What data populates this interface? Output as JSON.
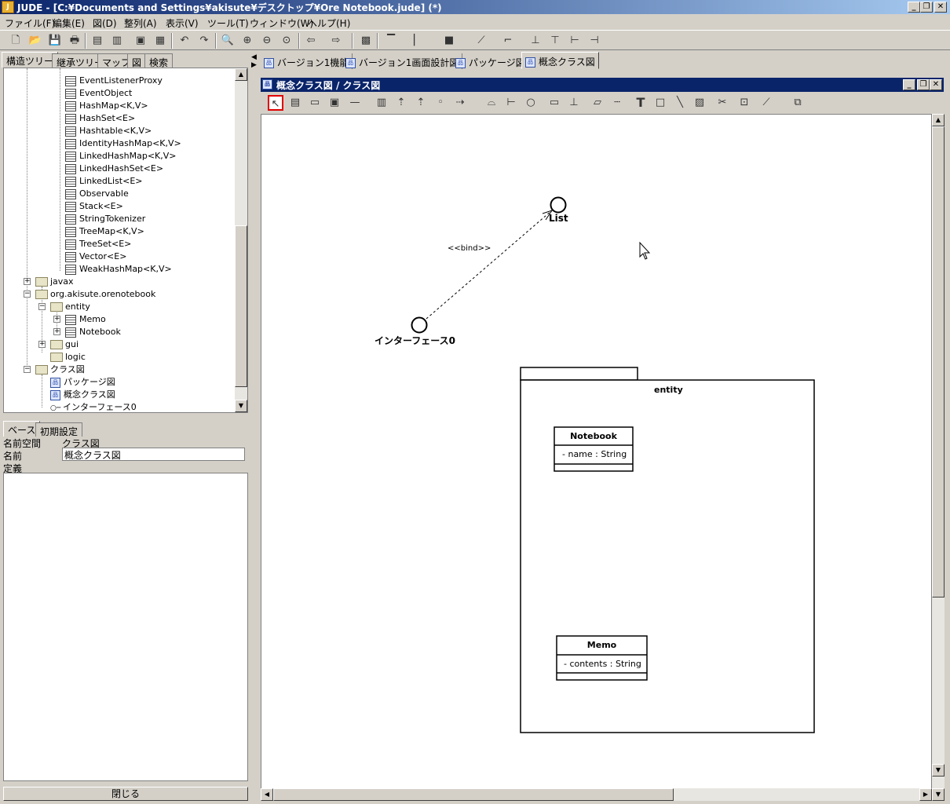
{
  "window": {
    "title": "JUDE - [C:¥Documents and Settings¥akisute¥デスクトップ¥Ore Notebook.jude] (*)",
    "icon_label": "J"
  },
  "menu": [
    "ファイル(F)",
    "編集(E)",
    "図(D)",
    "整列(A)",
    "表示(V)",
    "ツール(T)",
    "ウィンドウ(W)",
    "ヘルプ(H)"
  ],
  "left_tabs": [
    "構造ツリー",
    "継承ツリー",
    "マップ",
    "図",
    "検索"
  ],
  "tree": {
    "classes": [
      "EventListenerProxy",
      "EventObject",
      "HashMap<K,V>",
      "HashSet<E>",
      "Hashtable<K,V>",
      "IdentityHashMap<K,V>",
      "LinkedHashMap<K,V>",
      "LinkedHashSet<E>",
      "LinkedList<E>",
      "Observable",
      "Stack<E>",
      "StringTokenizer",
      "TreeMap<K,V>",
      "TreeSet<E>",
      "Vector<E>",
      "WeakHashMap<K,V>"
    ],
    "javax": "javax",
    "org": "org.akisute.orenotebook",
    "entity": "entity",
    "memo": "Memo",
    "notebook": "Notebook",
    "gui": "gui",
    "logic": "logic",
    "classdiagram": "クラス図",
    "package_diagram": "パッケージ図",
    "concept_diagram": "概念クラス図",
    "interface0": "インターフェース0"
  },
  "prop_tabs": [
    "ベース",
    "初期設定"
  ],
  "props": {
    "namespace_label": "名前空間",
    "namespace_value": "クラス図",
    "name_label": "名前",
    "name_value": "概念クラス図",
    "definition_label": "定義"
  },
  "close_label": "閉じる",
  "diagram_tabs": [
    "バージョン1機能",
    "バージョン1画面設計図",
    "パッケージ図",
    "概念クラス図"
  ],
  "frame_title": "概念クラス図 / クラス図",
  "diagram": {
    "iface_list": "List",
    "iface0": "インターフェース0",
    "bind": "<<bind>>",
    "package": "entity",
    "notebook_name": "Notebook",
    "notebook_attr": "- name : String",
    "memo_name": "Memo",
    "memo_attr": "- contents : String"
  }
}
